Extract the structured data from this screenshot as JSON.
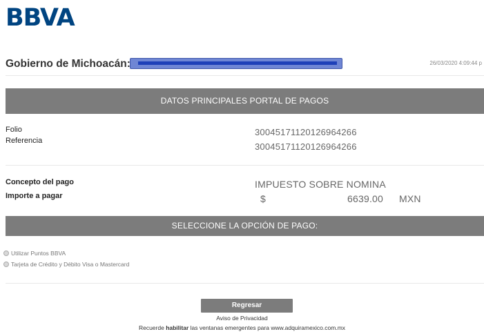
{
  "logo": "BBVA",
  "header": {
    "entity_prefix": "Gobierno de Michoacán:A",
    "date": "26/03/2020 4:09:44 p"
  },
  "sections": {
    "main_title": "DATOS PRINCIPALES PORTAL DE PAGOS",
    "payment_option_title": "SELECCIONE LA OPCIÓN DE PAGO:"
  },
  "details": {
    "folio_label": "Folio",
    "folio_value": "30045171120126964266",
    "referencia_label": "Referencia",
    "referencia_value": "30045171120126964266",
    "concepto_label": "Concepto del pago",
    "concepto_value": "IMPUESTO SOBRE NOMINA",
    "importe_label": "Importe a pagar",
    "currency_symbol": "$",
    "amount": "6639.00",
    "currency": "MXN"
  },
  "options": [
    {
      "label": "Utilizar Puntos BBVA",
      "selected": false
    },
    {
      "label": "Tarjeta de Crédito y Débito Visa o Mastercard",
      "selected": false
    }
  ],
  "footer": {
    "back_button": "Regresar",
    "privacy_link": "Aviso de Privacidad",
    "note_prefix": "Recuerde ",
    "note_bold": "habilitar",
    "note_suffix": " las ventanas emergentes para www.adquiramexico.com.mx"
  }
}
